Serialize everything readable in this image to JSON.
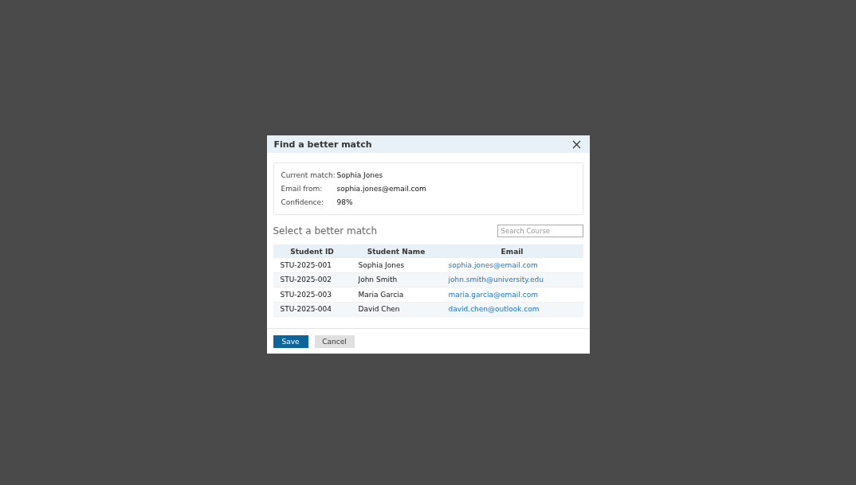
{
  "dialog": {
    "title": "Find a better match"
  },
  "current": [
    {
      "label": "Current match:",
      "value": "Sophia Jones"
    },
    {
      "label": "Email from:",
      "value": "sophia.jones@email.com"
    },
    {
      "label": "Confidence:",
      "value": "98%"
    }
  ],
  "section_title": "Select a better match",
  "search": {
    "placeholder": "Search Course"
  },
  "table": {
    "columns": [
      "Student ID",
      "Student Name",
      "Email"
    ],
    "rows": [
      {
        "id": "STU-2025-001",
        "name": "Sophia Jones",
        "email": "sophia.jones@email.com"
      },
      {
        "id": "STU-2025-002",
        "name": "John Smith",
        "email": "john.smith@university.edu"
      },
      {
        "id": "STU-2025-003",
        "name": "Maria Garcia",
        "email": "maria.garcia@email.com"
      },
      {
        "id": "STU-2025-004",
        "name": "David Chen",
        "email": "david.chen@outlook.com"
      }
    ]
  },
  "buttons": [
    {
      "label": "Save",
      "kind": "primary"
    },
    {
      "label": "Cancel",
      "kind": "secondary"
    }
  ]
}
